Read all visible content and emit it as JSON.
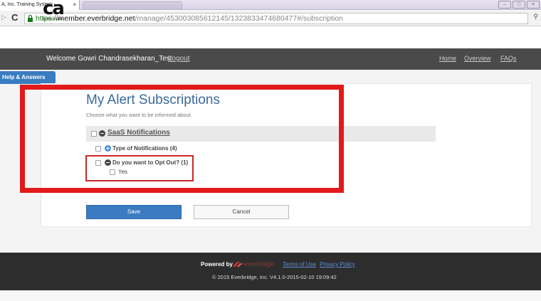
{
  "browser": {
    "tab_title": "A, Inc. Training System -",
    "tab_close": "×",
    "url_https": "https://",
    "url_host": "member.everbridge.net",
    "url_path": "/manage/453003085612145/1323833474680477#/subscription"
  },
  "logo": {
    "mark": "ca",
    "sub": "technologies"
  },
  "topnav": {
    "welcome": "Welcome Gowri Chandrasekharan_Test",
    "logout": "Logout",
    "home": "Home",
    "overview": "Overview",
    "faqs": "FAQs"
  },
  "help_tab": "Help & Answers",
  "main": {
    "title": "My Alert Subscriptions",
    "subtitle": "Choose what you want to be informed about.",
    "group": {
      "label": "SaaS Notifications",
      "items": [
        {
          "label": "Type of Notifications (4)",
          "expanded": false
        },
        {
          "label": "Do you want to Opt Out? (1)",
          "expanded": true,
          "options": [
            {
              "label": "Yes",
              "checked": false
            }
          ]
        }
      ]
    },
    "save_label": "Save",
    "cancel_label": "Cancel"
  },
  "highlight_color": "#e11a1a",
  "footer": {
    "powered_by": "Powered by",
    "brand": "everbridge",
    "terms": "Terms of Use",
    "privacy": "Privacy Policy",
    "copyright": "© 2015 Everbridge, Inc. V4.1.0-2015-02-10 19:09:42"
  }
}
